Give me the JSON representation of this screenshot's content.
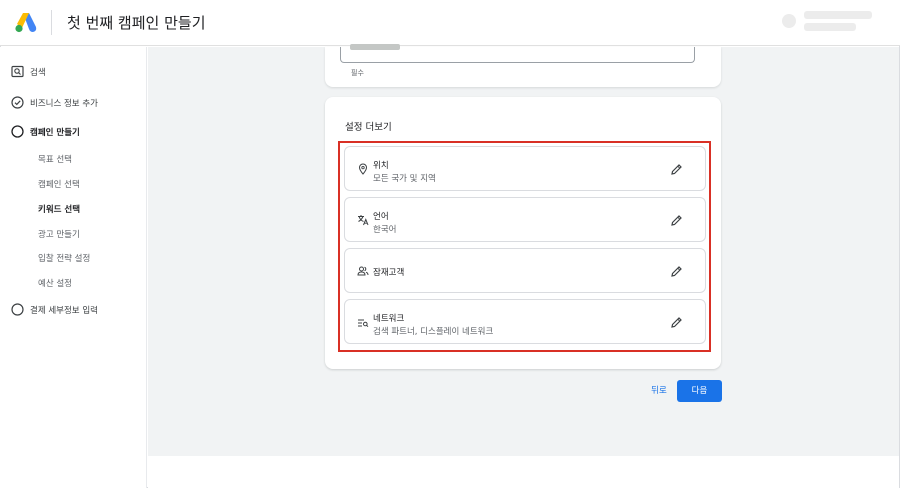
{
  "header": {
    "title": "첫 번째 캠페인 만들기"
  },
  "sidebar": {
    "items": [
      {
        "label": "검색",
        "icon": "search-icon"
      },
      {
        "label": "비즈니스 정보 추가",
        "icon": "check-circle-icon"
      },
      {
        "label": "캠페인 만들기",
        "icon": "circle-icon"
      },
      {
        "label": "결제 세부정보 입력",
        "icon": "circle-icon"
      }
    ],
    "subitems": [
      {
        "label": "목표 선택"
      },
      {
        "label": "캠페인 선택"
      },
      {
        "label": "키워드 선택"
      },
      {
        "label": "광고 만들기"
      },
      {
        "label": "입찰 전략 설정"
      },
      {
        "label": "예산 설정"
      }
    ]
  },
  "form": {
    "required": "필수"
  },
  "settings": {
    "title": "설정 더보기",
    "rows": [
      {
        "title": "위치",
        "subtitle": "모든 국가 및 지역",
        "icon": "location-pin-icon"
      },
      {
        "title": "언어",
        "subtitle": "한국어",
        "icon": "translate-icon"
      },
      {
        "title": "잠재고객",
        "subtitle": "",
        "icon": "people-icon"
      },
      {
        "title": "네트워크",
        "subtitle": "검색 파트너, 디스플레이 네트워크",
        "icon": "network-icon"
      }
    ]
  },
  "actions": {
    "back": "뒤로",
    "next": "다음"
  },
  "colors": {
    "accent": "#1a73e8",
    "highlight": "#d93025",
    "background": "#f1f3f4"
  }
}
